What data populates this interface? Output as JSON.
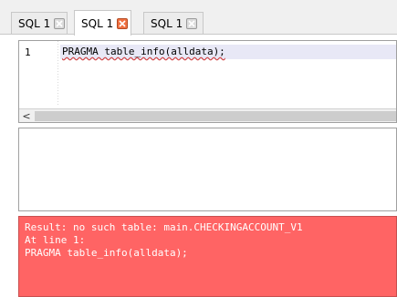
{
  "tabs": [
    {
      "label": "SQL 1",
      "active": false
    },
    {
      "label": "SQL 1",
      "active": true
    },
    {
      "label": "SQL 1",
      "active": false
    }
  ],
  "editor": {
    "line_number": "1",
    "code": "PRAGMA table_info(alldata);"
  },
  "scrollbar": {
    "left_arrow": "<"
  },
  "message": {
    "lines": [
      "Result: no such table: main.CHECKINGACCOUNT_V1",
      "At line 1:",
      "PRAGMA table_info(alldata);"
    ]
  },
  "colors": {
    "error_background": "#ff6464",
    "active_close_button": "#f07040"
  }
}
